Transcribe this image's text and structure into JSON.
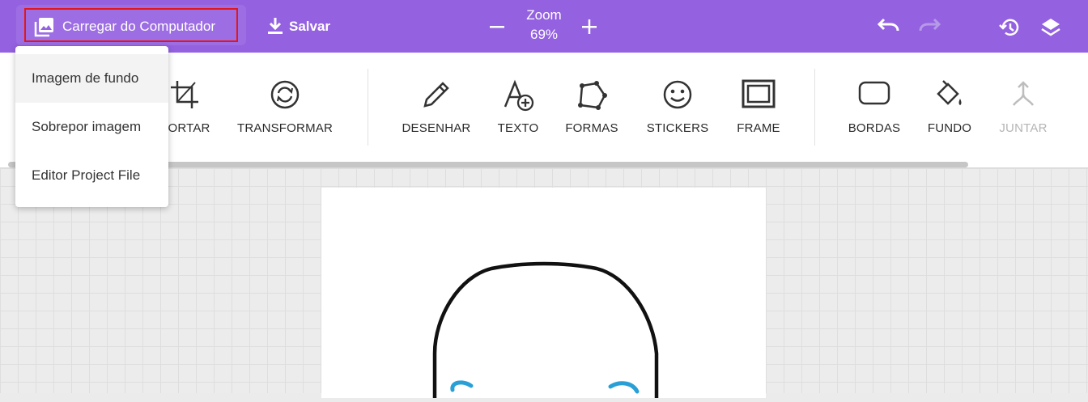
{
  "topbar": {
    "upload_label": "Carregar do Computador",
    "save_label": "Salvar",
    "zoom_title": "Zoom",
    "zoom_value": "69%",
    "icons": [
      "image-upload-icon",
      "download-icon",
      "minus-icon",
      "plus-icon",
      "undo-icon",
      "redo-icon",
      "history-icon",
      "layers-icon"
    ]
  },
  "toolbar": {
    "tools": [
      {
        "label": "CORTAR",
        "icon": "crop-icon"
      },
      {
        "label": "TRANSFORMAR",
        "icon": "transform-icon"
      },
      {
        "label": "DESENHAR",
        "icon": "pencil-icon"
      },
      {
        "label": "TEXTO",
        "icon": "text-add-icon"
      },
      {
        "label": "FORMAS",
        "icon": "polygon-icon"
      },
      {
        "label": "STICKERS",
        "icon": "smiley-icon"
      },
      {
        "label": "FRAME",
        "icon": "frame-icon"
      },
      {
        "label": "BORDAS",
        "icon": "rounded-rect-icon"
      },
      {
        "label": "FUNDO",
        "icon": "paint-bucket-icon"
      },
      {
        "label": "JUNTAR",
        "icon": "merge-icon"
      }
    ]
  },
  "dropdown": {
    "items": [
      {
        "label": "Imagem de fundo"
      },
      {
        "label": "Sobrepor imagem"
      },
      {
        "label": "Editor Project File"
      }
    ]
  },
  "colors": {
    "topbar": "#9461e0",
    "highlight": "#e0181e",
    "drawing_stroke": "#111111",
    "drawing_accent": "#2a9fd6"
  }
}
